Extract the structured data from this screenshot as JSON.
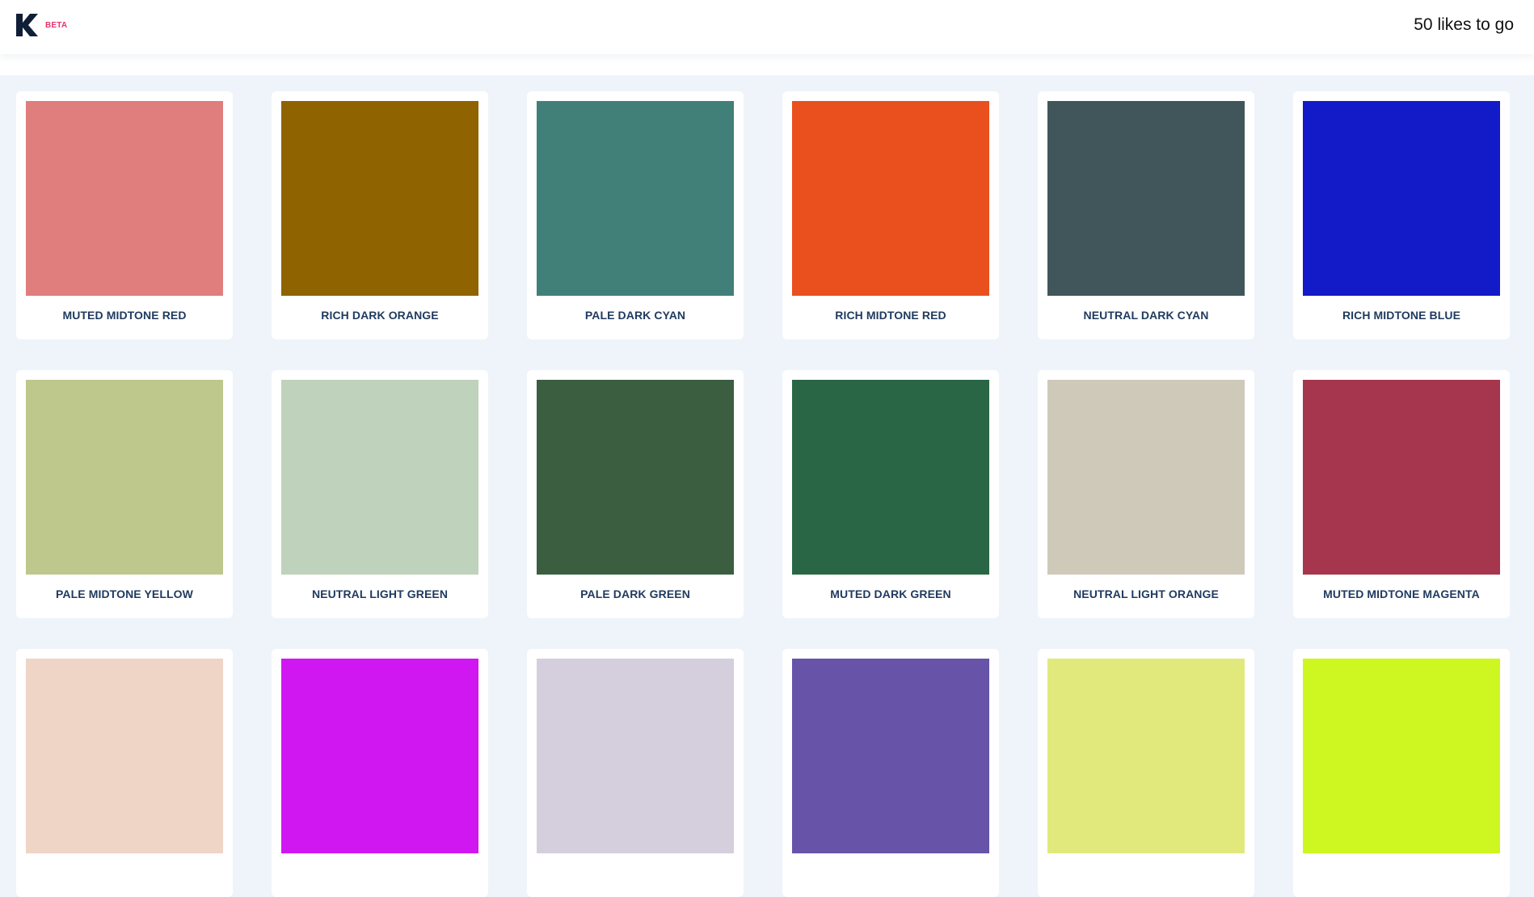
{
  "header": {
    "beta_label": "BETA",
    "likes_text": "50 likes to go",
    "logo_color": "#0f1f38",
    "beta_color": "#e8336d"
  },
  "cards": [
    {
      "label": "MUTED MIDTONE RED",
      "color": "#e07d7d"
    },
    {
      "label": "RICH DARK ORANGE",
      "color": "#8f6300"
    },
    {
      "label": "PALE DARK CYAN",
      "color": "#418078"
    },
    {
      "label": "RICH MIDTONE RED",
      "color": "#e9501e"
    },
    {
      "label": "NEUTRAL DARK CYAN",
      "color": "#40565a"
    },
    {
      "label": "RICH MIDTONE BLUE",
      "color": "#131ac8"
    },
    {
      "label": "PALE MIDTONE YELLOW",
      "color": "#bec78c"
    },
    {
      "label": "NEUTRAL LIGHT GREEN",
      "color": "#bfd2bb"
    },
    {
      "label": "PALE DARK GREEN",
      "color": "#3b5e41"
    },
    {
      "label": "MUTED DARK GREEN",
      "color": "#296645"
    },
    {
      "label": "NEUTRAL LIGHT ORANGE",
      "color": "#cfc9b9"
    },
    {
      "label": "MUTED MIDTONE MAGENTA",
      "color": "#a6364d"
    },
    {
      "label": "",
      "color": "#efd5c6"
    },
    {
      "label": "",
      "color": "#d117f1"
    },
    {
      "label": "",
      "color": "#d5cfdd"
    },
    {
      "label": "",
      "color": "#6753a8"
    },
    {
      "label": "",
      "color": "#e2e97c"
    },
    {
      "label": "",
      "color": "#cef620"
    }
  ]
}
